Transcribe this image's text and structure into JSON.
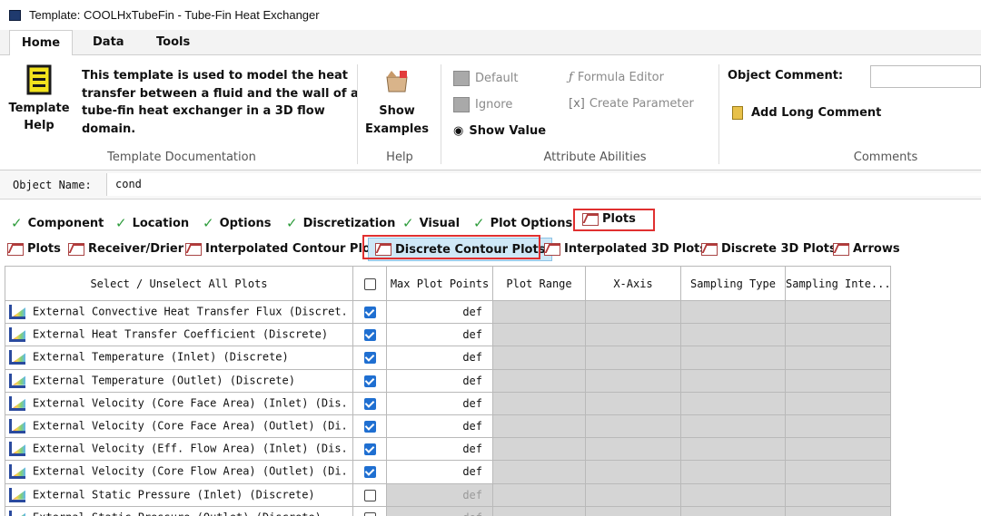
{
  "window": {
    "title": "Template: COOLHxTubeFin - Tube-Fin Heat Exchanger"
  },
  "ribbon_tabs": [
    "Home",
    "Data",
    "Tools"
  ],
  "ribbon": {
    "template_help": {
      "line1": "Template",
      "line2": "Help"
    },
    "description": [
      "This template is used to model the heat",
      "transfer between a fluid and the wall of a",
      "tube-fin heat exchanger in a 3D flow",
      "domain."
    ],
    "group_template_doc": "Template Documentation",
    "show_examples": {
      "line1": "Show",
      "line2": "Examples"
    },
    "group_help": "Help",
    "default": "Default",
    "ignore": "Ignore",
    "show_value": "Show Value",
    "formula_editor": "Formula Editor",
    "create_parameter": "Create Parameter",
    "group_attribute": "Attribute Abilities",
    "object_comment": "Object Comment:",
    "add_long_comment": "Add Long Comment",
    "group_comments": "Comments"
  },
  "object_name": {
    "label": "Object Name:",
    "value": "cond"
  },
  "category_tabs": [
    "Component",
    "Location",
    "Options",
    "Discretization",
    "Visual",
    "Plot Options",
    "Plots"
  ],
  "sub_tabs": [
    "Plots",
    "Receiver/Drier",
    "Interpolated Contour Plots",
    "Discrete Contour Plots",
    "Interpolated 3D Plots",
    "Discrete 3D Plots",
    "Arrows"
  ],
  "grid": {
    "headers": [
      "Select / Unselect All Plots",
      "",
      "Max Plot Points",
      "Plot Range",
      "X-Axis",
      "Sampling Type",
      "Sampling Inte..."
    ],
    "rows": [
      {
        "name": "External Convective Heat Transfer Flux (Discret.",
        "checked": true,
        "max": "def"
      },
      {
        "name": "External Heat Transfer Coefficient (Discrete)",
        "checked": true,
        "max": "def"
      },
      {
        "name": "External Temperature (Inlet) (Discrete)",
        "checked": true,
        "max": "def"
      },
      {
        "name": "External Temperature (Outlet) (Discrete)",
        "checked": true,
        "max": "def"
      },
      {
        "name": "External Velocity (Core Face Area) (Inlet) (Dis.",
        "checked": true,
        "max": "def"
      },
      {
        "name": "External Velocity (Core Face Area) (Outlet) (Di.",
        "checked": true,
        "max": "def"
      },
      {
        "name": "External Velocity (Eff. Flow Area) (Inlet) (Dis.",
        "checked": true,
        "max": "def"
      },
      {
        "name": "External Velocity (Core Flow Area) (Outlet) (Di.",
        "checked": true,
        "max": "def"
      },
      {
        "name": "External Static Pressure (Inlet) (Discrete)",
        "checked": false,
        "max": "def"
      },
      {
        "name": "External Static Pressure (Outlet) (Discrete)",
        "checked": false,
        "max": "def"
      }
    ]
  }
}
